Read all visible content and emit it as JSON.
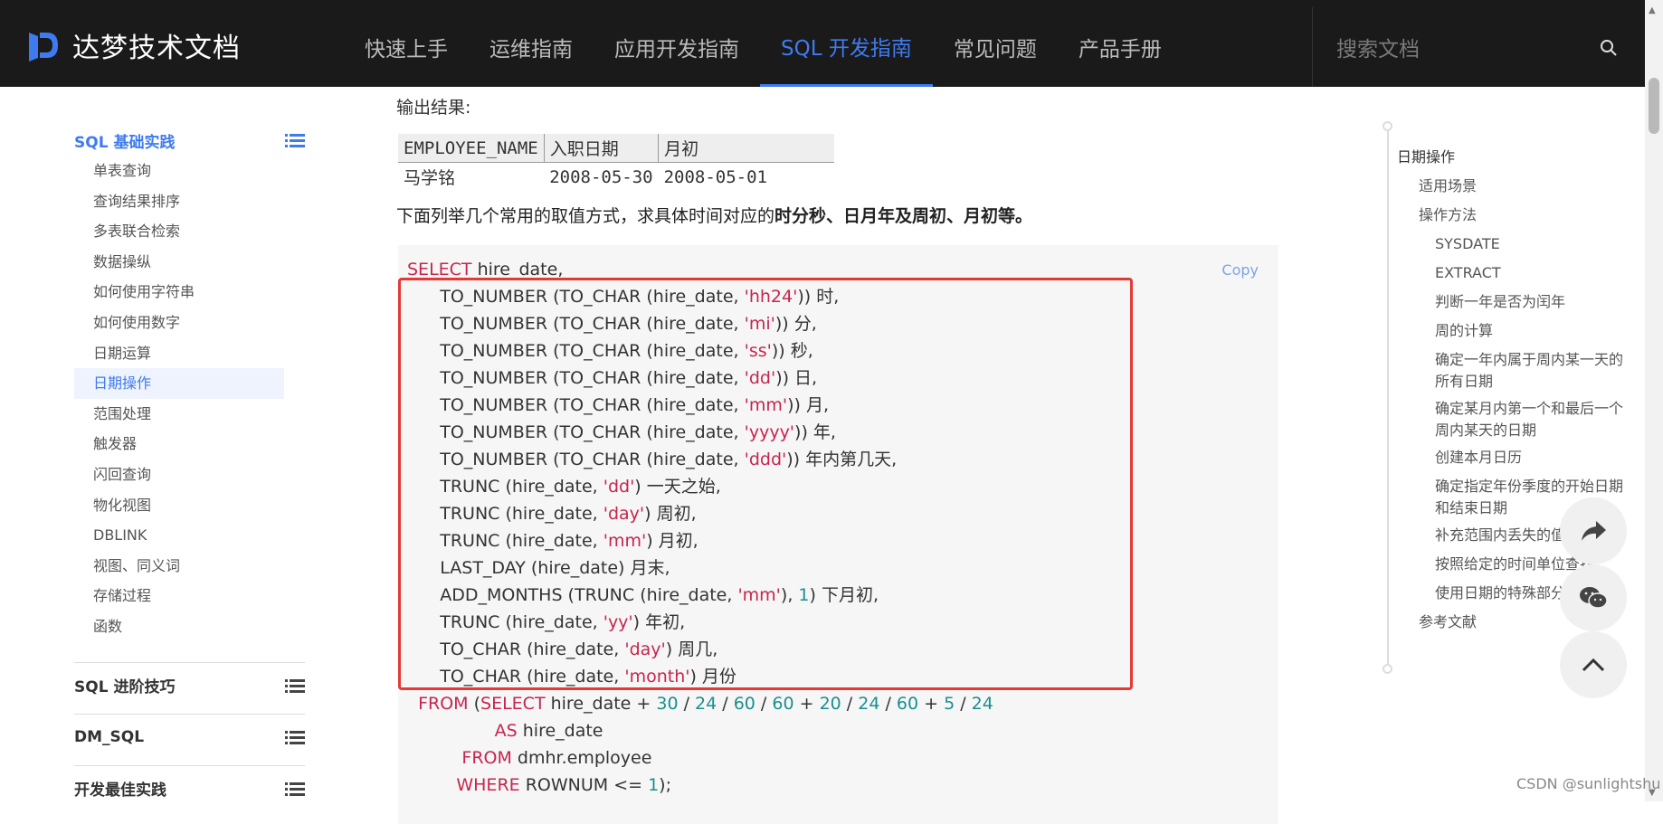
{
  "brand": {
    "name": "达梦技术文档",
    "color": "#3f7bf0"
  },
  "nav": {
    "items": [
      "快速上手",
      "运维指南",
      "应用开发指南",
      "SQL 开发指南",
      "常见问题",
      "产品手册"
    ],
    "active": "SQL 开发指南"
  },
  "search": {
    "placeholder": "搜索文档"
  },
  "sidebar": {
    "group1": {
      "title": "SQL 基础实践",
      "items": [
        "单表查询",
        "查询结果排序",
        "多表联合检索",
        "数据操纵",
        "如何使用字符串",
        "如何使用数字",
        "日期运算",
        "日期操作",
        "范围处理",
        "触发器",
        "闪回查询",
        "物化视图",
        "DBLINK",
        "视图、同义词",
        "存储过程",
        "函数"
      ],
      "active": "日期操作"
    },
    "group2": {
      "title": "SQL 进阶技巧"
    },
    "group3": {
      "title": "DM_SQL"
    },
    "group4": {
      "title": "开发最佳实践"
    }
  },
  "content": {
    "output_label": "输出结果:",
    "table": {
      "headers": [
        "EMPLOYEE_NAME",
        "入职日期",
        "月初"
      ],
      "rows": [
        [
          "马学铭",
          "2008-05-30",
          "2008-05-01"
        ]
      ]
    },
    "desc_prefix": "下面列举几个常用的取值方式，求具体时间对应的",
    "desc_bold": "时分秒、日月年及周初、月初等。",
    "copy_label": "Copy",
    "code_lines": [
      [
        [
          "kw",
          "SELECT"
        ],
        [
          "t",
          " hire_date,"
        ]
      ],
      [
        [
          "t",
          "      TO_NUMBER (TO_CHAR (hire_date, "
        ],
        [
          "str",
          "'hh24'"
        ],
        [
          "t",
          ")) 时,"
        ]
      ],
      [
        [
          "t",
          "      TO_NUMBER (TO_CHAR (hire_date, "
        ],
        [
          "str",
          "'mi'"
        ],
        [
          "t",
          ")) 分,"
        ]
      ],
      [
        [
          "t",
          "      TO_NUMBER (TO_CHAR (hire_date, "
        ],
        [
          "str",
          "'ss'"
        ],
        [
          "t",
          ")) 秒,"
        ]
      ],
      [
        [
          "t",
          "      TO_NUMBER (TO_CHAR (hire_date, "
        ],
        [
          "str",
          "'dd'"
        ],
        [
          "t",
          ")) 日,"
        ]
      ],
      [
        [
          "t",
          "      TO_NUMBER (TO_CHAR (hire_date, "
        ],
        [
          "str",
          "'mm'"
        ],
        [
          "t",
          ")) 月,"
        ]
      ],
      [
        [
          "t",
          "      TO_NUMBER (TO_CHAR (hire_date, "
        ],
        [
          "str",
          "'yyyy'"
        ],
        [
          "t",
          ")) 年,"
        ]
      ],
      [
        [
          "t",
          "      TO_NUMBER (TO_CHAR (hire_date, "
        ],
        [
          "str",
          "'ddd'"
        ],
        [
          "t",
          ")) 年内第几天,"
        ]
      ],
      [
        [
          "t",
          "      TRUNC (hire_date, "
        ],
        [
          "str",
          "'dd'"
        ],
        [
          "t",
          ") 一天之始,"
        ]
      ],
      [
        [
          "t",
          "      TRUNC (hire_date, "
        ],
        [
          "str",
          "'day'"
        ],
        [
          "t",
          ") 周初,"
        ]
      ],
      [
        [
          "t",
          "      TRUNC (hire_date, "
        ],
        [
          "str",
          "'mm'"
        ],
        [
          "t",
          ") 月初,"
        ]
      ],
      [
        [
          "t",
          "      LAST_DAY (hire_date) 月末,"
        ]
      ],
      [
        [
          "t",
          "      ADD_MONTHS (TRUNC (hire_date, "
        ],
        [
          "str",
          "'mm'"
        ],
        [
          "t",
          "), "
        ],
        [
          "num",
          "1"
        ],
        [
          "t",
          ") 下月初,"
        ]
      ],
      [
        [
          "t",
          "      TRUNC (hire_date, "
        ],
        [
          "str",
          "'yy'"
        ],
        [
          "t",
          ") 年初,"
        ]
      ],
      [
        [
          "t",
          "      TO_CHAR (hire_date, "
        ],
        [
          "str",
          "'day'"
        ],
        [
          "t",
          ") 周几,"
        ]
      ],
      [
        [
          "t",
          "      TO_CHAR (hire_date, "
        ],
        [
          "str",
          "'month'"
        ],
        [
          "t",
          ") 月份"
        ]
      ],
      [
        [
          "t",
          "  "
        ],
        [
          "kw",
          "FROM"
        ],
        [
          "t",
          " ("
        ],
        [
          "kw",
          "SELECT"
        ],
        [
          "t",
          " hire_date + "
        ],
        [
          "num",
          "30"
        ],
        [
          "t",
          " / "
        ],
        [
          "num",
          "24"
        ],
        [
          "t",
          " / "
        ],
        [
          "num",
          "60"
        ],
        [
          "t",
          " / "
        ],
        [
          "num",
          "60"
        ],
        [
          "t",
          " + "
        ],
        [
          "num",
          "20"
        ],
        [
          "t",
          " / "
        ],
        [
          "num",
          "24"
        ],
        [
          "t",
          " / "
        ],
        [
          "num",
          "60"
        ],
        [
          "t",
          " + "
        ],
        [
          "num",
          "5"
        ],
        [
          "t",
          " / "
        ],
        [
          "num",
          "24"
        ]
      ],
      [
        [
          "t",
          "                "
        ],
        [
          "kw",
          "AS"
        ],
        [
          "t",
          " hire_date"
        ]
      ],
      [
        [
          "t",
          "          "
        ],
        [
          "kw",
          "FROM"
        ],
        [
          "t",
          " dmhr.employee"
        ]
      ],
      [
        [
          "t",
          "         "
        ],
        [
          "kw",
          "WHERE"
        ],
        [
          "t",
          " ROWNUM <= "
        ],
        [
          "num",
          "1"
        ],
        [
          "t",
          ");"
        ]
      ]
    ]
  },
  "toc": {
    "items": [
      {
        "label": "日期操作",
        "level": 1
      },
      {
        "label": "适用场景",
        "level": 2
      },
      {
        "label": "操作方法",
        "level": 2
      },
      {
        "label": "SYSDATE",
        "level": 3
      },
      {
        "label": "EXTRACT",
        "level": 3
      },
      {
        "label": "判断一年是否为闰年",
        "level": 3
      },
      {
        "label": "周的计算",
        "level": 3
      },
      {
        "label": "确定一年内属于周内某一天的所有日期",
        "level": 3
      },
      {
        "label": "确定某月内第一个和最后一个周内某天的日期",
        "level": 3
      },
      {
        "label": "创建本月日历",
        "level": 3
      },
      {
        "label": "确定指定年份季度的开始日期和结束日期",
        "level": 3
      },
      {
        "label": "补充范围内丢失的值",
        "level": 3
      },
      {
        "label": "按照给定的时间单位查找",
        "level": 3
      },
      {
        "label": "使用日期的特殊部分比较记录",
        "level": 3
      },
      {
        "label": "参考文献",
        "level": 2
      }
    ]
  },
  "watermark": "CSDN @sunlightshu"
}
